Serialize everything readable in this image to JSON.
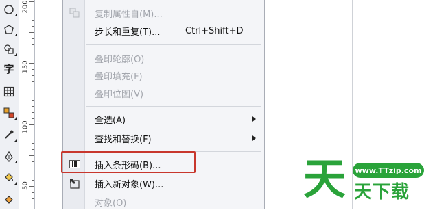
{
  "ruler": {
    "marks": [
      "200",
      "150",
      "100",
      "50"
    ]
  },
  "toolbox": {
    "text_tool_label": "字"
  },
  "menu": {
    "items": [
      {
        "label": "复制属性自(M)...",
        "shortcut": "",
        "disabled": true,
        "icon": "copy-properties-icon"
      },
      {
        "label": "步长和重复(T)...",
        "shortcut": "Ctrl+Shift+D",
        "disabled": false
      },
      {
        "label": "叠印轮廓(O)",
        "disabled": true
      },
      {
        "label": "叠印填充(F)",
        "disabled": true
      },
      {
        "label": "叠印位图(V)",
        "disabled": true
      },
      {
        "label": "全选(A)",
        "disabled": false,
        "submenu": true
      },
      {
        "label": "查找和替换(F)",
        "disabled": false,
        "submenu": true
      },
      {
        "label": "插入条形码(B)...",
        "disabled": false,
        "icon": "barcode-icon",
        "highlighted": true
      },
      {
        "label": "插入新对象(W)...",
        "disabled": false,
        "icon": "insert-object-icon"
      },
      {
        "label": "对象(O)",
        "disabled": true
      }
    ]
  },
  "watermark": {
    "url": "www.TTzip.com",
    "big_char": "天",
    "small_text": "天下载"
  },
  "colors": {
    "highlight_border": "#c8372d",
    "brand_green": "#2aa33a"
  }
}
